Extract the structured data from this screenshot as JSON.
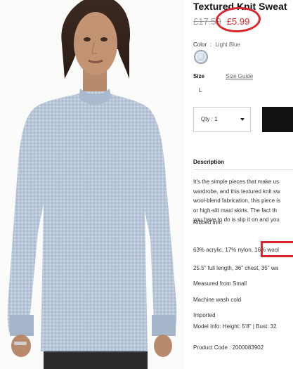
{
  "product": {
    "title": "Textured Knit Sweat",
    "old_price": "£17.50",
    "new_price": "£5.99",
    "color_label": "Color",
    "color_sep": ":",
    "color_value": "Light Blue",
    "size_label": "Size",
    "size_guide": "Size Guide",
    "size_option": "L",
    "qty_label": "Qty : 1"
  },
  "description": {
    "heading": "Description",
    "paragraph": [
      "It's the simple pieces that make us",
      "wardrobe, and this textured knit sw",
      "wool-blend fabrication, this piece is",
      "or high-slit maxi skirts. The fact th",
      "you have to do is slip it on and you"
    ],
    "details": [
      "Ribbed trim",
      "63% acrylic, 17% nylon, 16% wool",
      "25.5\" full length, 36\" chest, 35\" wa",
      "Measured from Small",
      "Machine wash cold",
      "Imported",
      "Model Info: Height: 5'8\" | Bust: 32",
      "Product Code : 2000083902"
    ]
  },
  "colors": {
    "accent_red": "#d9252c",
    "sweater": "#b9c7d8",
    "button": "#111111"
  }
}
